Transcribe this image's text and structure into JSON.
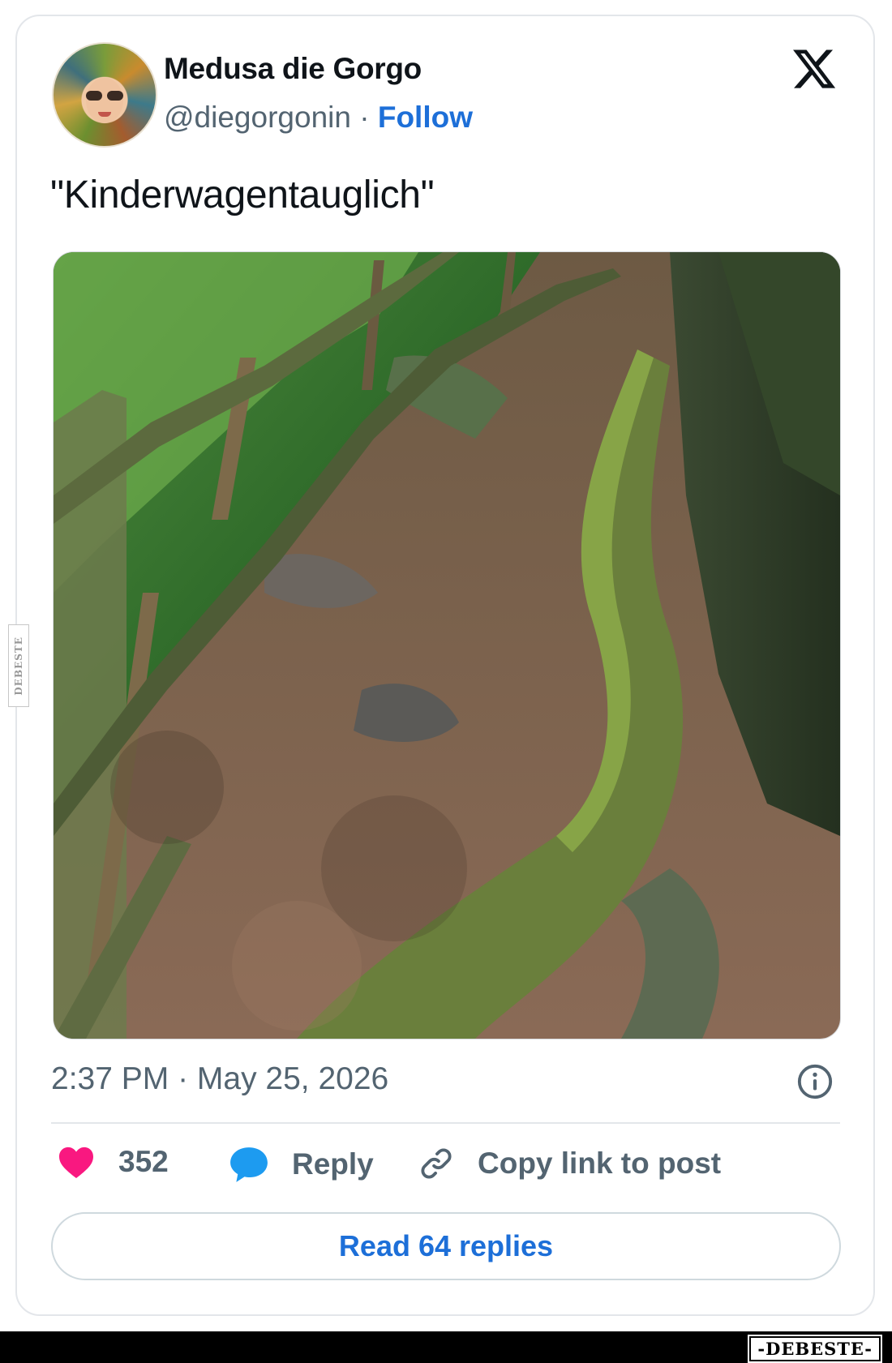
{
  "post": {
    "author": {
      "name": "Medusa die Gorgo",
      "handle": "@diegorgonin",
      "separator": " · ",
      "follow_label": "Follow"
    },
    "platform_icon": "x-logo-icon",
    "text": "\"Kinderwagentauglich\"",
    "media": {
      "kind": "photo",
      "icon": "forest-path-photo"
    },
    "timestamp": "2:37 PM · May 25, 2026",
    "info_icon": "info-icon",
    "actions": {
      "like_count": "352",
      "reply_label": "Reply",
      "copy_label": "Copy link to post"
    },
    "read_replies_label": "Read 64 replies"
  },
  "watermark": {
    "side_text": "DEBESTE",
    "footer_brand": "-DEBESTE-"
  },
  "colors": {
    "accent": "#1d6fd8",
    "like": "#f91880",
    "reply_bubble": "#1d9bf0",
    "text_primary": "#0f1419",
    "text_secondary": "#536471"
  }
}
